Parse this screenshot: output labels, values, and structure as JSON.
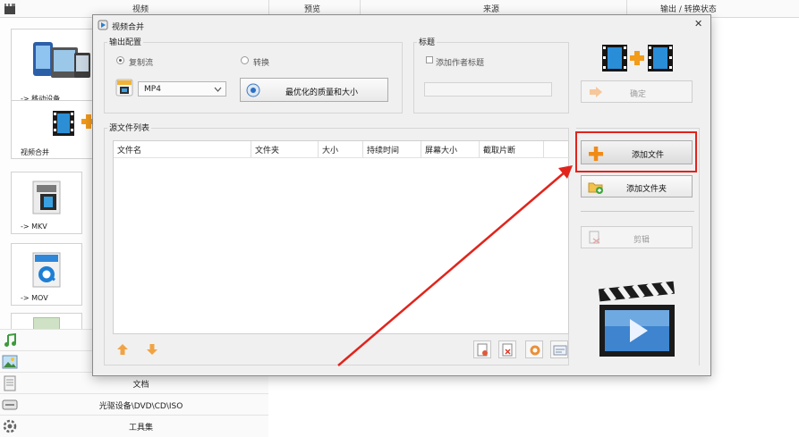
{
  "app": {
    "header": {
      "col_video": "视频",
      "col_preview": "预览",
      "col_source": "来源",
      "col_output": "输出 / 转换状态"
    },
    "left_tiles": [
      {
        "label": "-> 移动设备",
        "icon": "mobile-devices-icon"
      },
      {
        "label": "视频合并",
        "icon": "video-join-icon"
      },
      {
        "label": "-> MKV",
        "icon": "mkv-file-icon"
      },
      {
        "label": "-> MOV",
        "icon": "mov-quicktime-icon"
      }
    ],
    "categories": [
      {
        "label": "",
        "icon": "music-note-icon"
      },
      {
        "label": "",
        "icon": "picture-icon"
      },
      {
        "label": "文档",
        "icon": "document-icon"
      },
      {
        "label": "光驱设备\\DVD\\CD\\ISO",
        "icon": "disc-drive-icon"
      },
      {
        "label": "工具集",
        "icon": "toolbox-gear-icon"
      }
    ]
  },
  "dialog": {
    "title": "视频合并",
    "output_config": {
      "title": "输出配置",
      "radio_copy": "复制流",
      "radio_convert": "转换",
      "radio_selected": "copy",
      "format_value": "MP4",
      "quality_label": "最优化的质量和大小"
    },
    "title_group": {
      "title": "标题",
      "checkbox_label": "添加作者标题",
      "checked": false,
      "input_value": ""
    },
    "ok_label": "确定",
    "source_list": {
      "title": "源文件列表",
      "columns": [
        "文件名",
        "文件夹",
        "大小",
        "持续时间",
        "屏幕大小",
        "截取片断"
      ]
    },
    "buttons": {
      "add_file": "添加文件",
      "add_folder": "添加文件夹",
      "edit": "剪辑"
    }
  }
}
